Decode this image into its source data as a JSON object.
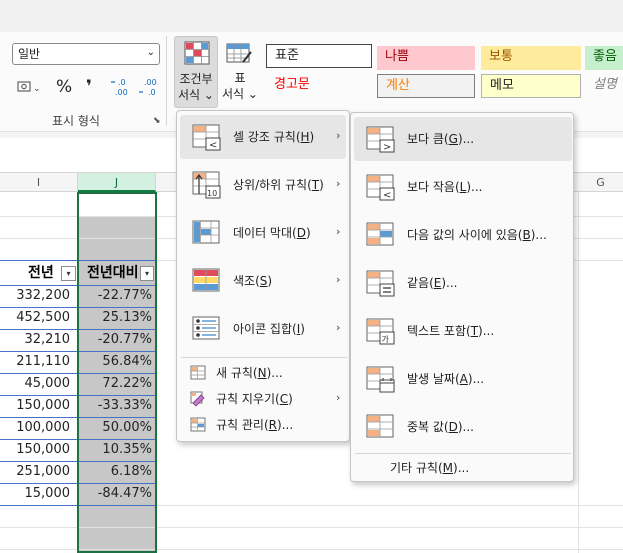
{
  "ribbon": {
    "number_format": {
      "value": "일반",
      "group_label": "표시 형식"
    },
    "cond_format_button": {
      "line1": "조건부",
      "line2": "서식 ⌄"
    },
    "table_format_button": {
      "line1": "표",
      "line2": "서식 ⌄"
    },
    "cell_styles": {
      "row1": [
        {
          "label": "표준",
          "bg": "#ffffff",
          "fg": "#000000"
        },
        {
          "label": "나쁨",
          "bg": "#ffc7ce",
          "fg": "#9c0006"
        },
        {
          "label": "보통",
          "bg": "#ffeb9c",
          "fg": "#9c5700"
        },
        {
          "label": "좋음",
          "bg": "#c6efce",
          "fg": "#006100"
        }
      ],
      "row2": [
        {
          "label": "경고문",
          "bg": "#f3f3f3",
          "fg": "#ff0000"
        },
        {
          "label": "계산",
          "bg": "#f2f2f2",
          "fg": "#fa7d00"
        },
        {
          "label": "메모",
          "bg": "#ffffcc",
          "fg": "#000000"
        },
        {
          "label": "설명",
          "bg": "#f3f3f3",
          "fg": "#7f7f7f"
        }
      ]
    }
  },
  "sheet": {
    "columns": [
      "I",
      "J"
    ],
    "column_header_right": "G",
    "headers": {
      "prev_year": "전년",
      "yoy": "전년대비"
    },
    "rows": [
      {
        "prev": "332,200",
        "yoy": "-22.77%"
      },
      {
        "prev": "452,500",
        "yoy": "25.13%"
      },
      {
        "prev": "32,210",
        "yoy": "-20.77%"
      },
      {
        "prev": "211,110",
        "yoy": "56.84%"
      },
      {
        "prev": "45,000",
        "yoy": "72.22%"
      },
      {
        "prev": "150,000",
        "yoy": "-33.33%"
      },
      {
        "prev": "100,000",
        "yoy": "50.00%"
      },
      {
        "prev": "150,000",
        "yoy": "10.35%"
      },
      {
        "prev": "251,000",
        "yoy": "6.18%"
      },
      {
        "prev": "15,000",
        "yoy": "-84.47%"
      }
    ]
  },
  "main_menu": {
    "items": [
      {
        "label": "셀 강조 규칙(",
        "key": "H",
        "tail": ")"
      },
      {
        "label": "상위/하위 규칙(",
        "key": "T",
        "tail": ")"
      },
      {
        "label": "데이터 막대(",
        "key": "D",
        "tail": ")"
      },
      {
        "label": "색조(",
        "key": "S",
        "tail": ")"
      },
      {
        "label": "아이콘 집합(",
        "key": "I",
        "tail": ")"
      }
    ],
    "small_items": [
      {
        "label": "새 규칙(",
        "key": "N",
        "tail": ")..."
      },
      {
        "label": "규칙 지우기(",
        "key": "C",
        "tail": ")"
      },
      {
        "label": "규칙 관리(",
        "key": "R",
        "tail": ")..."
      }
    ]
  },
  "sub_menu": {
    "items": [
      {
        "label": "보다 큼(",
        "key": "G",
        "tail": ")..."
      },
      {
        "label": "보다 작음(",
        "key": "L",
        "tail": ")..."
      },
      {
        "label": "다음 값의 사이에 있음(",
        "key": "B",
        "tail": ")..."
      },
      {
        "label": "같음(",
        "key": "E",
        "tail": ")..."
      },
      {
        "label": "텍스트 포함(",
        "key": "T",
        "tail": ")..."
      },
      {
        "label": "발생 날짜(",
        "key": "A",
        "tail": ")..."
      },
      {
        "label": "중복 값(",
        "key": "D",
        "tail": ")..."
      }
    ],
    "more": {
      "label": "기타 규칙(",
      "key": "M",
      "tail": ")..."
    }
  }
}
